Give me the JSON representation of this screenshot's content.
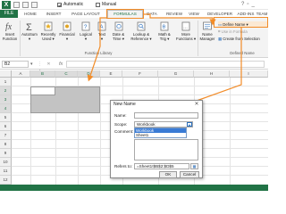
{
  "quick_access": {
    "automatic_label": "Automatic",
    "manual_label": "Manual"
  },
  "tabs": {
    "file": "FILE",
    "items": [
      "HOME",
      "INSERT",
      "PAGE LAYOUT",
      "FORMULAS",
      "DATA",
      "REVIEW",
      "VIEW",
      "DEVELOPER",
      "ADD-INS",
      "TEAM"
    ]
  },
  "ribbon": {
    "buttons": [
      "Insert\nFunction",
      "AutoSum\n▾",
      "Recently\nUsed ▾",
      "Financial\n▾",
      "Logical\n▾",
      "Text\n▾",
      "Date &\nTime ▾",
      "Lookup &\nReference ▾",
      "Math &\nTrig ▾",
      "More\nFunctions ▾",
      "Name\nManager"
    ],
    "function_library_label": "Function Library",
    "defined_names_label": "Defined Name",
    "define_name_label": "Define Name",
    "use_in_formula_label": "Use in Formula",
    "create_from_selection_label": "Create from Selection"
  },
  "formula_bar": {
    "name_box": "B2"
  },
  "grid": {
    "columns": [
      "A",
      "B",
      "C",
      "D",
      "E",
      "F",
      "G",
      "H",
      "I"
    ],
    "rows": [
      "1",
      "2",
      "3",
      "4",
      "5",
      "6",
      "7",
      "8",
      "9",
      "10",
      "11",
      "12"
    ]
  },
  "dialog": {
    "title": "New Name",
    "name_label": "Name:",
    "scope_label": "Scope:",
    "scope_value": "Workbook",
    "scope_options": [
      "Workbook",
      "Sheet1"
    ],
    "comment_label": "Comment:",
    "refers_to_label": "Refers to:",
    "refers_to_value": "=Sheet1!$B$2:$D$5",
    "ok_label": "OK",
    "cancel_label": "Cancel"
  },
  "colors": {
    "accent": "#217346",
    "callout": "#f28c28"
  }
}
